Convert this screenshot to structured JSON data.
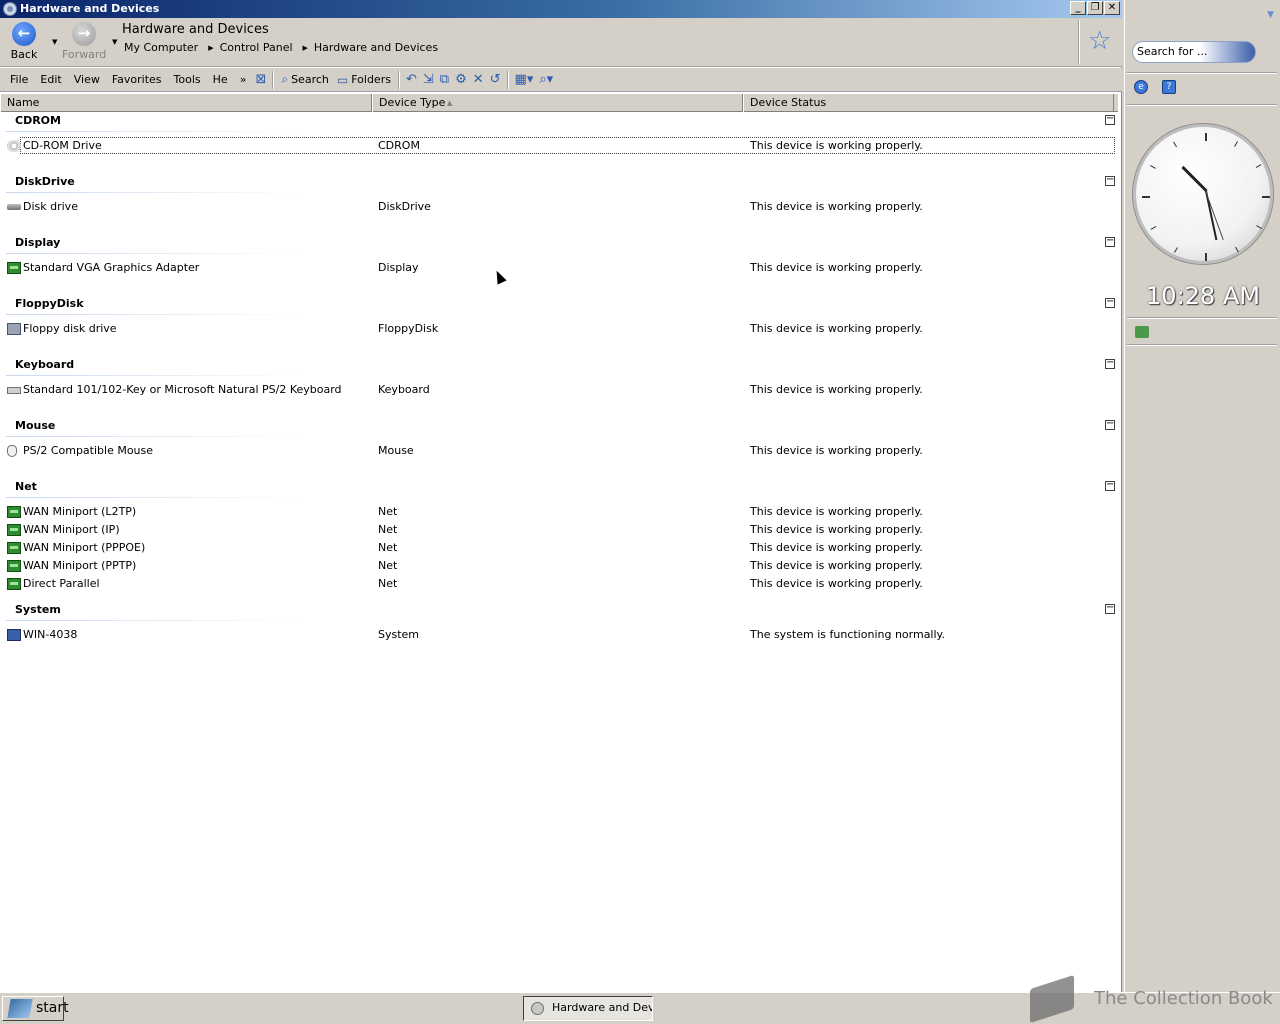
{
  "window": {
    "title": "Hardware and Devices",
    "buttons": {
      "minimize": "_",
      "restore": "❐",
      "close": "✕"
    }
  },
  "nav": {
    "back_label": "Back",
    "forward_label": "Forward",
    "address_title": "Hardware and Devices",
    "breadcrumbs": [
      "My Computer",
      "Control Panel",
      "Hardware and Devices"
    ]
  },
  "menu": {
    "items": [
      "File",
      "Edit",
      "View",
      "Favorites",
      "Tools",
      "He"
    ],
    "overflow": "»",
    "search_label": "Search",
    "folders_label": "Folders"
  },
  "columns": {
    "name": "Name",
    "type": "Device Type",
    "status": "Device Status"
  },
  "groups": [
    {
      "name": "CDROM",
      "rows": [
        {
          "icon": "cdrom-icon",
          "name": "CD-ROM Drive",
          "type": "CDROM",
          "status": "This device is working properly."
        }
      ]
    },
    {
      "name": "DiskDrive",
      "rows": [
        {
          "icon": "disk-drive-icon",
          "name": "Disk drive",
          "type": "DiskDrive",
          "status": "This device is working properly."
        }
      ]
    },
    {
      "name": "Display",
      "rows": [
        {
          "icon": "display-adapter-icon",
          "name": "Standard VGA Graphics Adapter",
          "type": "Display",
          "status": "This device is working properly."
        }
      ]
    },
    {
      "name": "FloppyDisk",
      "rows": [
        {
          "icon": "floppy-drive-icon",
          "name": "Floppy disk drive",
          "type": "FloppyDisk",
          "status": "This device is working properly."
        }
      ]
    },
    {
      "name": "Keyboard",
      "rows": [
        {
          "icon": "keyboard-icon",
          "name": "Standard 101/102-Key or Microsoft Natural PS/2 Keyboard",
          "type": "Keyboard",
          "status": "This device is working properly."
        }
      ]
    },
    {
      "name": "Mouse",
      "rows": [
        {
          "icon": "mouse-icon",
          "name": "PS/2 Compatible Mouse",
          "type": "Mouse",
          "status": "This device is working properly."
        }
      ]
    },
    {
      "name": "Net",
      "rows": [
        {
          "icon": "network-adapter-icon",
          "name": "WAN Miniport (L2TP)",
          "type": "Net",
          "status": "This device is working properly."
        },
        {
          "icon": "network-adapter-icon",
          "name": "WAN Miniport (IP)",
          "type": "Net",
          "status": "This device is working properly."
        },
        {
          "icon": "network-adapter-icon",
          "name": "WAN Miniport (PPPOE)",
          "type": "Net",
          "status": "This device is working properly."
        },
        {
          "icon": "network-adapter-icon",
          "name": "WAN Miniport (PPTP)",
          "type": "Net",
          "status": "This device is working properly."
        },
        {
          "icon": "network-adapter-icon",
          "name": "Direct Parallel",
          "type": "Net",
          "status": "This device is working properly."
        }
      ]
    },
    {
      "name": "System",
      "rows": [
        {
          "icon": "computer-icon",
          "name": "WIN-4038",
          "type": "System",
          "status": "The system is functioning normally."
        }
      ]
    }
  ],
  "sidebar": {
    "search_placeholder": "Search for ...",
    "clock_time": "10:28 AM"
  },
  "taskbar": {
    "start_label": "start",
    "task_label": "Hardware and Devic"
  },
  "watermark": {
    "text": "The Collection Book"
  },
  "colors": {
    "titlebar_start": "#0a246a",
    "titlebar_end": "#a6caf0",
    "chrome": "#d4d0c8"
  }
}
